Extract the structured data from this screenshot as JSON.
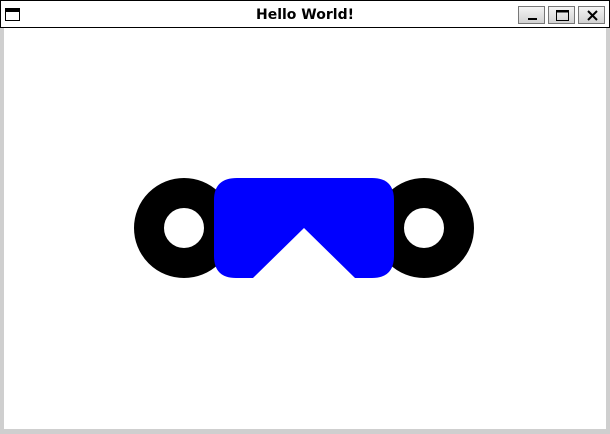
{
  "window": {
    "title": "Hello World!",
    "controls": {
      "minimize": "minimize-icon",
      "maximize": "maximize-icon",
      "close": "close-icon"
    }
  },
  "canvas": {
    "background": "#ffffff",
    "ring_color": "#000000",
    "body_color": "#0000ff"
  }
}
